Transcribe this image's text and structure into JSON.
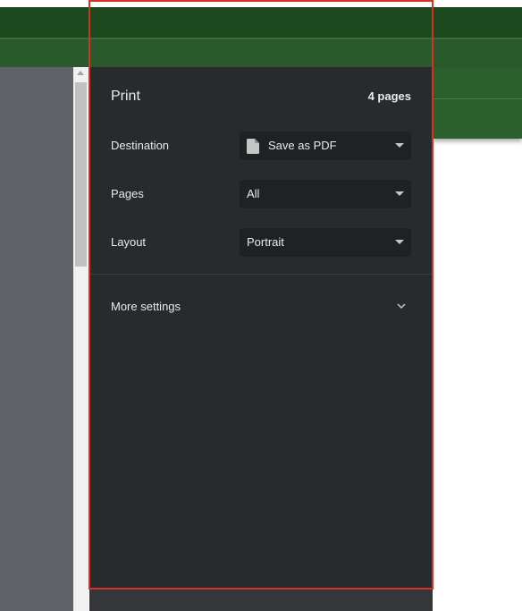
{
  "print": {
    "title": "Print",
    "pages_count": "4 pages",
    "destination": {
      "label": "Destination",
      "value": "Save as PDF",
      "icon": "file-icon"
    },
    "pages": {
      "label": "Pages",
      "value": "All"
    },
    "layout": {
      "label": "Layout",
      "value": "Portrait"
    },
    "more_settings": {
      "label": "More settings",
      "icon": "chevron-down-icon"
    }
  },
  "colors": {
    "panel_bg": "#292a2d",
    "select_bg": "#202124",
    "highlight_outline": "#d93025",
    "header_green": "#1c4a1e"
  }
}
